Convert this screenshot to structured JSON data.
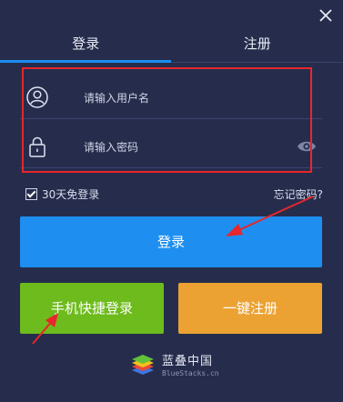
{
  "tabs": {
    "login": "登录",
    "register": "注册"
  },
  "form": {
    "username_placeholder": "请输入用户名",
    "password_placeholder": "请输入密码"
  },
  "remember_label": "30天免登录",
  "forgot_label": "忘记密码?",
  "buttons": {
    "login": "登录",
    "phone_login": "手机快捷登录",
    "one_click_register": "一键注册"
  },
  "brand": {
    "name_cn": "蓝叠中国",
    "domain": "BlueStacks.cn"
  },
  "colors": {
    "background": "#262d4c",
    "tab_active": "#1a8df0",
    "login_button": "#1e8ff0",
    "phone_button": "#6dbb1c",
    "register_button": "#eba233",
    "annotation": "#e8262b"
  },
  "icons": [
    "close-icon",
    "user-icon",
    "lock-icon",
    "eye-icon",
    "checkmark-icon",
    "bluestacks-logo"
  ]
}
